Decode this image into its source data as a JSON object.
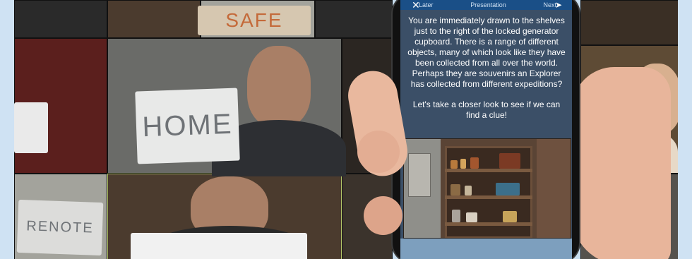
{
  "scene": {
    "signs": {
      "home": "HOME",
      "remote": "RENOTE",
      "safe": "SAFE"
    }
  },
  "phone": {
    "navbar": {
      "left_label": "Later",
      "center_label": "Presentation",
      "right_label": "Next"
    },
    "story": {
      "paragraph1": "You are immediately drawn to the shelves just to the right of the locked generator cupboard. There is a range of different objects, many of which look like they have been collected from all over the world. Perhaps they are souvenirs an Explorer has collected from different expeditions?",
      "paragraph2": "Let's take a closer look to see if we can find a clue!"
    }
  }
}
